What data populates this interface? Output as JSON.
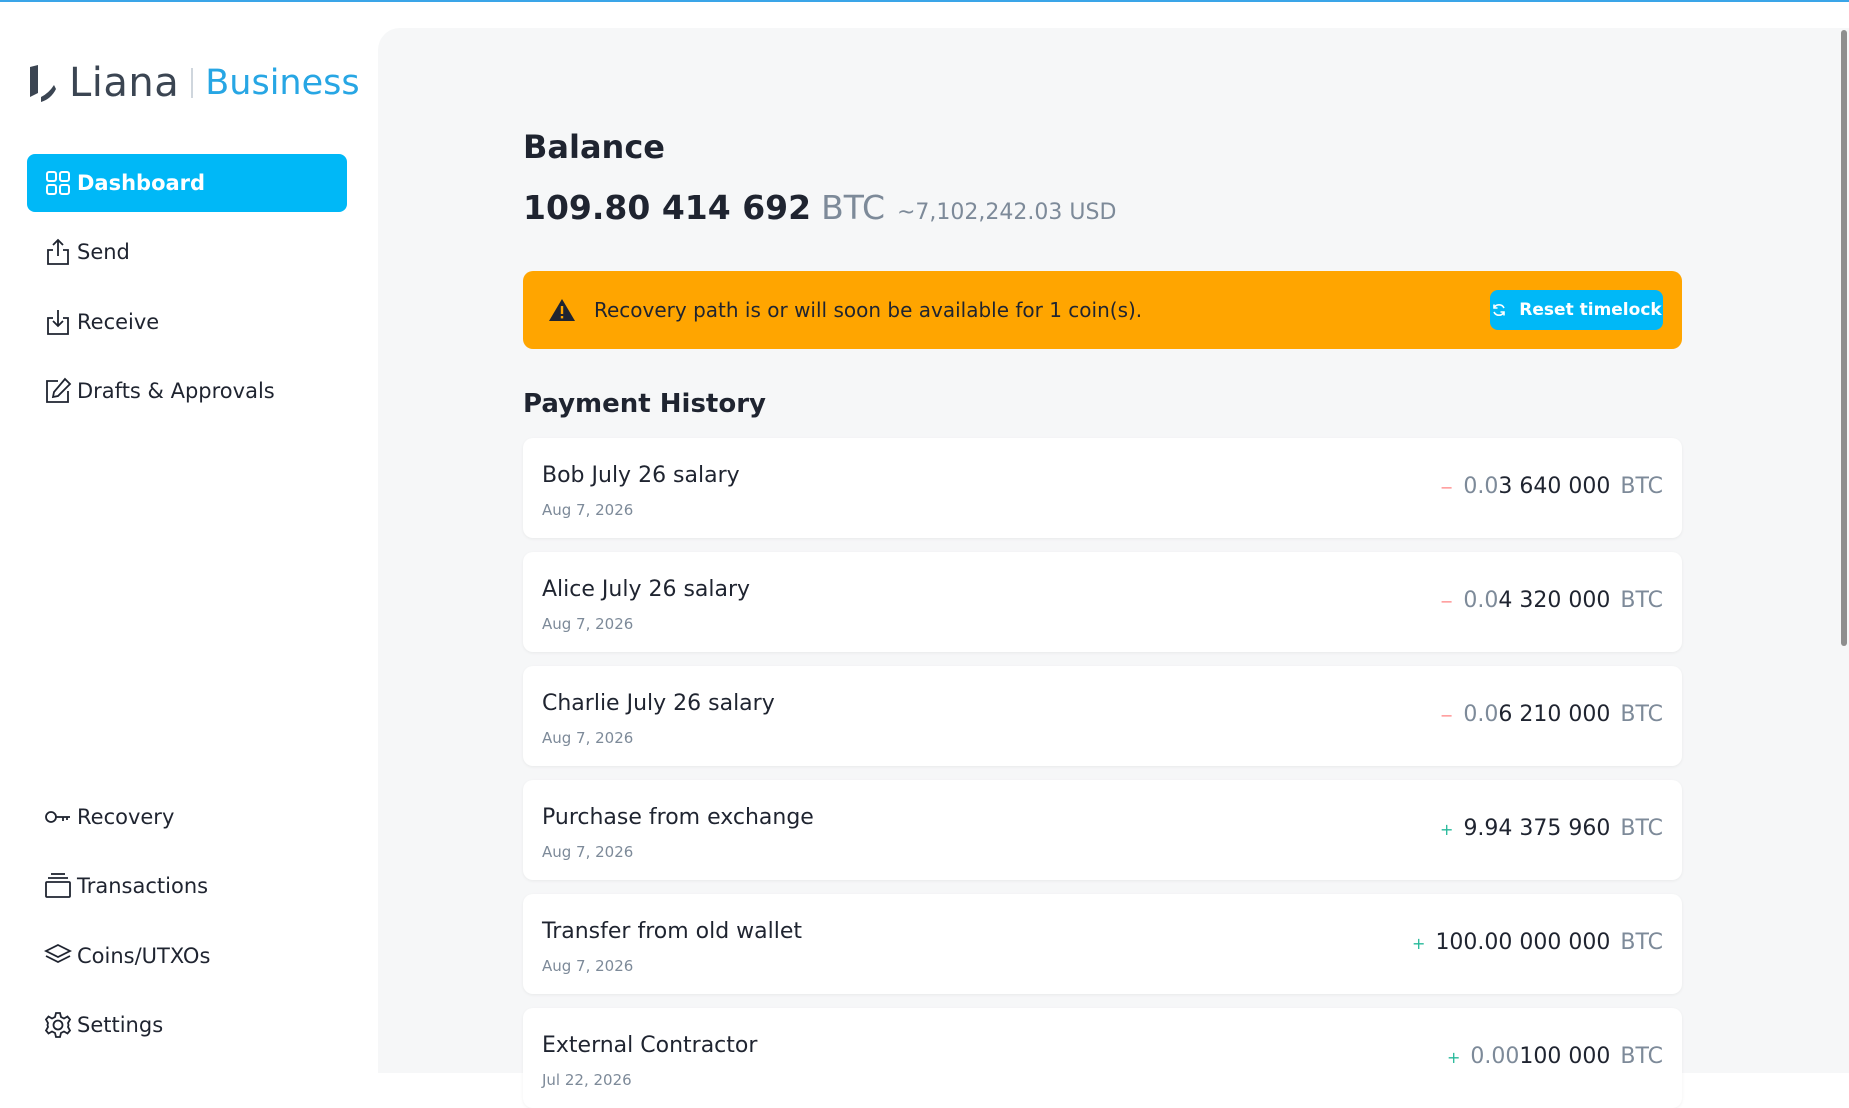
{
  "app": {
    "logo_name": "Liana",
    "logo_sub": "Business",
    "accent": "#00b8f7",
    "logo_accent": "#27a6e4",
    "warning_color": "#ffa500"
  },
  "sidebar": {
    "top_items": [
      {
        "label": "Dashboard",
        "icon": "dashboard-icon",
        "active": true
      },
      {
        "label": "Send",
        "icon": "send-icon",
        "active": false
      },
      {
        "label": "Receive",
        "icon": "receive-icon",
        "active": false
      },
      {
        "label": "Drafts & Approvals",
        "icon": "edit-icon",
        "active": false
      }
    ],
    "bottom_items": [
      {
        "label": "Recovery",
        "icon": "key-icon"
      },
      {
        "label": "Transactions",
        "icon": "stack-icon"
      },
      {
        "label": "Coins/UTXOs",
        "icon": "layers-icon"
      },
      {
        "label": "Settings",
        "icon": "gear-icon"
      }
    ]
  },
  "main": {
    "balance_title": "Balance",
    "balance_amount": "109.80 414 692",
    "balance_unit": "BTC",
    "balance_usd": "~7,102,242.03 USD",
    "alert": {
      "message": "Recovery path is or will soon be available for 1 coin(s).",
      "button_label": "Reset timelock"
    },
    "history_title": "Payment History",
    "transactions": [
      {
        "label": "Bob July 26 salary",
        "date": "Aug 7, 2026",
        "sign": "−",
        "direction": "out",
        "amount_dim": "0.0",
        "amount_bright": "3 640 000",
        "unit": "BTC"
      },
      {
        "label": "Alice July 26 salary",
        "date": "Aug 7, 2026",
        "sign": "−",
        "direction": "out",
        "amount_dim": "0.0",
        "amount_bright": "4 320 000",
        "unit": "BTC"
      },
      {
        "label": "Charlie July 26 salary",
        "date": "Aug 7, 2026",
        "sign": "−",
        "direction": "out",
        "amount_dim": "0.0",
        "amount_bright": "6 210 000",
        "unit": "BTC"
      },
      {
        "label": "Purchase from exchange",
        "date": "Aug 7, 2026",
        "sign": "+",
        "direction": "in",
        "amount_dim": "",
        "amount_bright": "9.94 375 960",
        "unit": "BTC"
      },
      {
        "label": "Transfer from old wallet",
        "date": "Aug 7, 2026",
        "sign": "+",
        "direction": "in",
        "amount_dim": "",
        "amount_bright": "100.00 000 000",
        "unit": "BTC"
      },
      {
        "label": "External Contractor",
        "date": "Jul 22, 2026",
        "sign": "+",
        "direction": "in",
        "amount_dim": "0.00 ",
        "amount_bright": "100 000",
        "unit": "BTC"
      }
    ]
  }
}
